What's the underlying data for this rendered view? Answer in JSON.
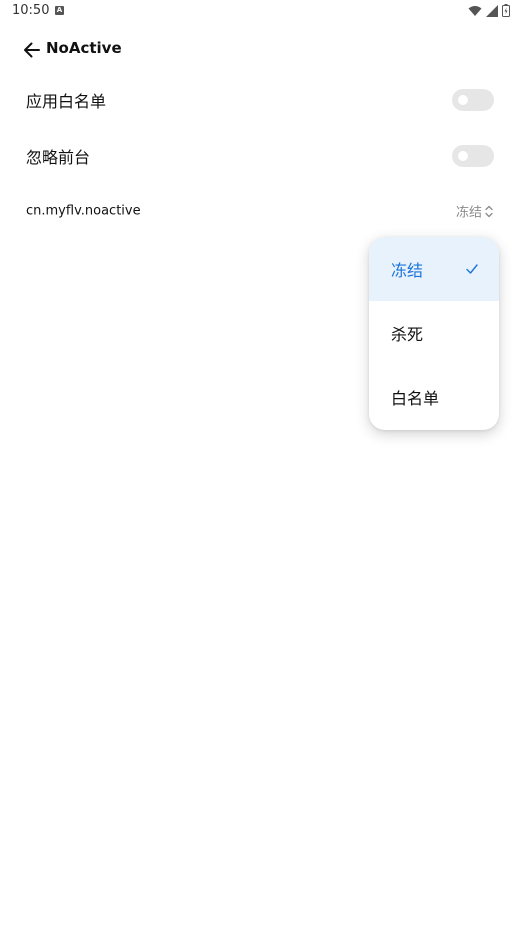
{
  "status_bar": {
    "time": "10:50",
    "notification_icon": "a-icon",
    "icons": [
      "wifi-icon",
      "signal-icon",
      "battery-icon"
    ]
  },
  "app_bar": {
    "back_icon": "arrow-left-icon",
    "title": "NoActive"
  },
  "settings": {
    "app_whitelist": {
      "label": "应用白名单",
      "enabled": false
    },
    "ignore_foreground": {
      "label": "忽略前台",
      "enabled": false
    },
    "package": {
      "name": "cn.myflv.noactive",
      "value": "冻结",
      "icon": "chevron-up-down-icon"
    }
  },
  "dropdown": {
    "selected": "冻结",
    "items": [
      {
        "label": "冻结",
        "selected": true
      },
      {
        "label": "杀死",
        "selected": false
      },
      {
        "label": "白名单",
        "selected": false
      }
    ]
  },
  "colors": {
    "accent": "#1a73d9",
    "selected_bg": "#e8f2fd",
    "toggle_off": "#e6e6e6",
    "secondary_text": "#8a8a8a"
  }
}
